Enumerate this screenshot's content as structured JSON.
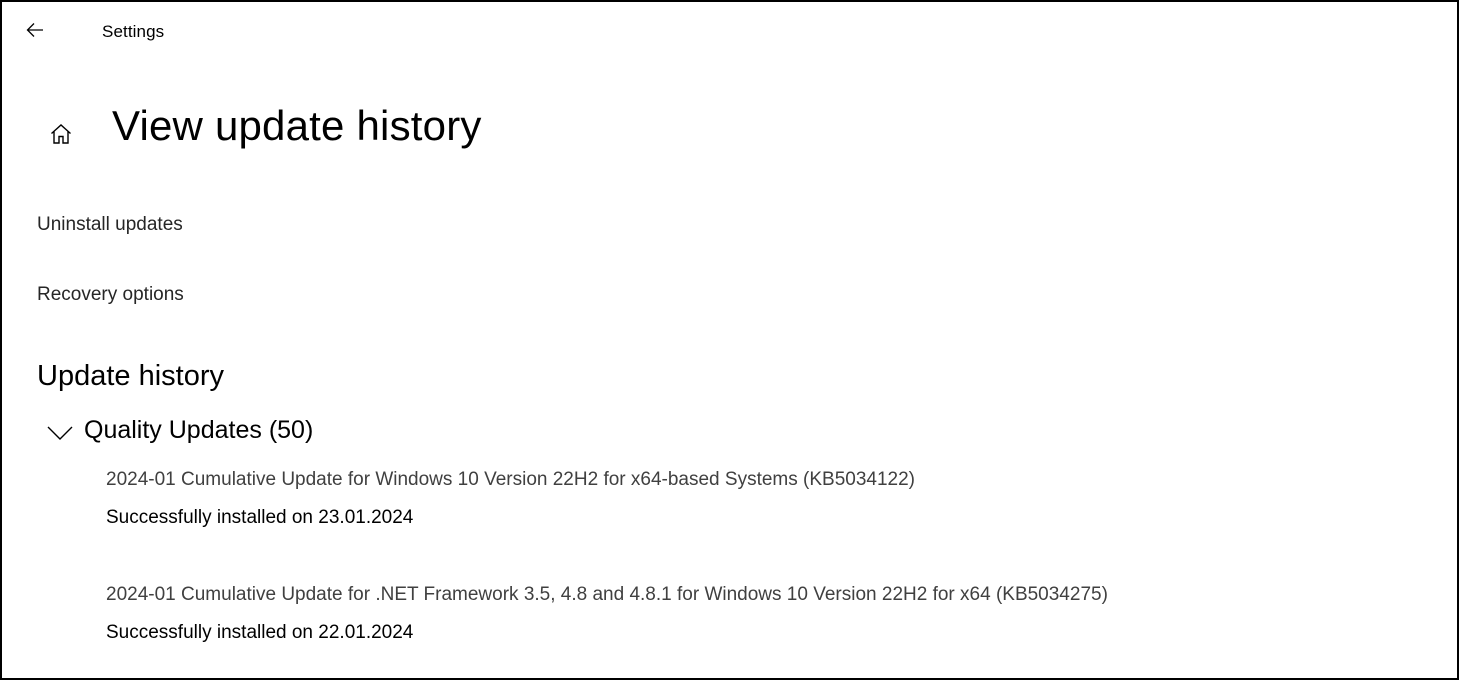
{
  "titlebar": {
    "back_icon": "back-arrow-icon",
    "title": "Settings"
  },
  "header": {
    "home_icon": "home-icon",
    "title": "View update history"
  },
  "links": {
    "uninstall": "Uninstall updates",
    "recovery": "Recovery options"
  },
  "history": {
    "section_title": "Update history",
    "groups": [
      {
        "icon": "chevron-down-icon",
        "label": "Quality Updates (50)",
        "expanded": true,
        "items": [
          {
            "title": "2024-01 Cumulative Update for Windows 10 Version 22H2 for x64-based Systems (KB5034122)",
            "status": "Successfully installed on 23.01.2024"
          },
          {
            "title": "2024-01 Cumulative Update for .NET Framework 3.5, 4.8 and 4.8.1 for Windows 10 Version 22H2 for x64 (KB5034275)",
            "status": "Successfully installed on 22.01.2024"
          }
        ]
      }
    ]
  },
  "colors": {
    "background": "#ffffff",
    "text": "#000000",
    "link_text": "#262626",
    "update_title_text": "#404040",
    "border": "#000000"
  }
}
